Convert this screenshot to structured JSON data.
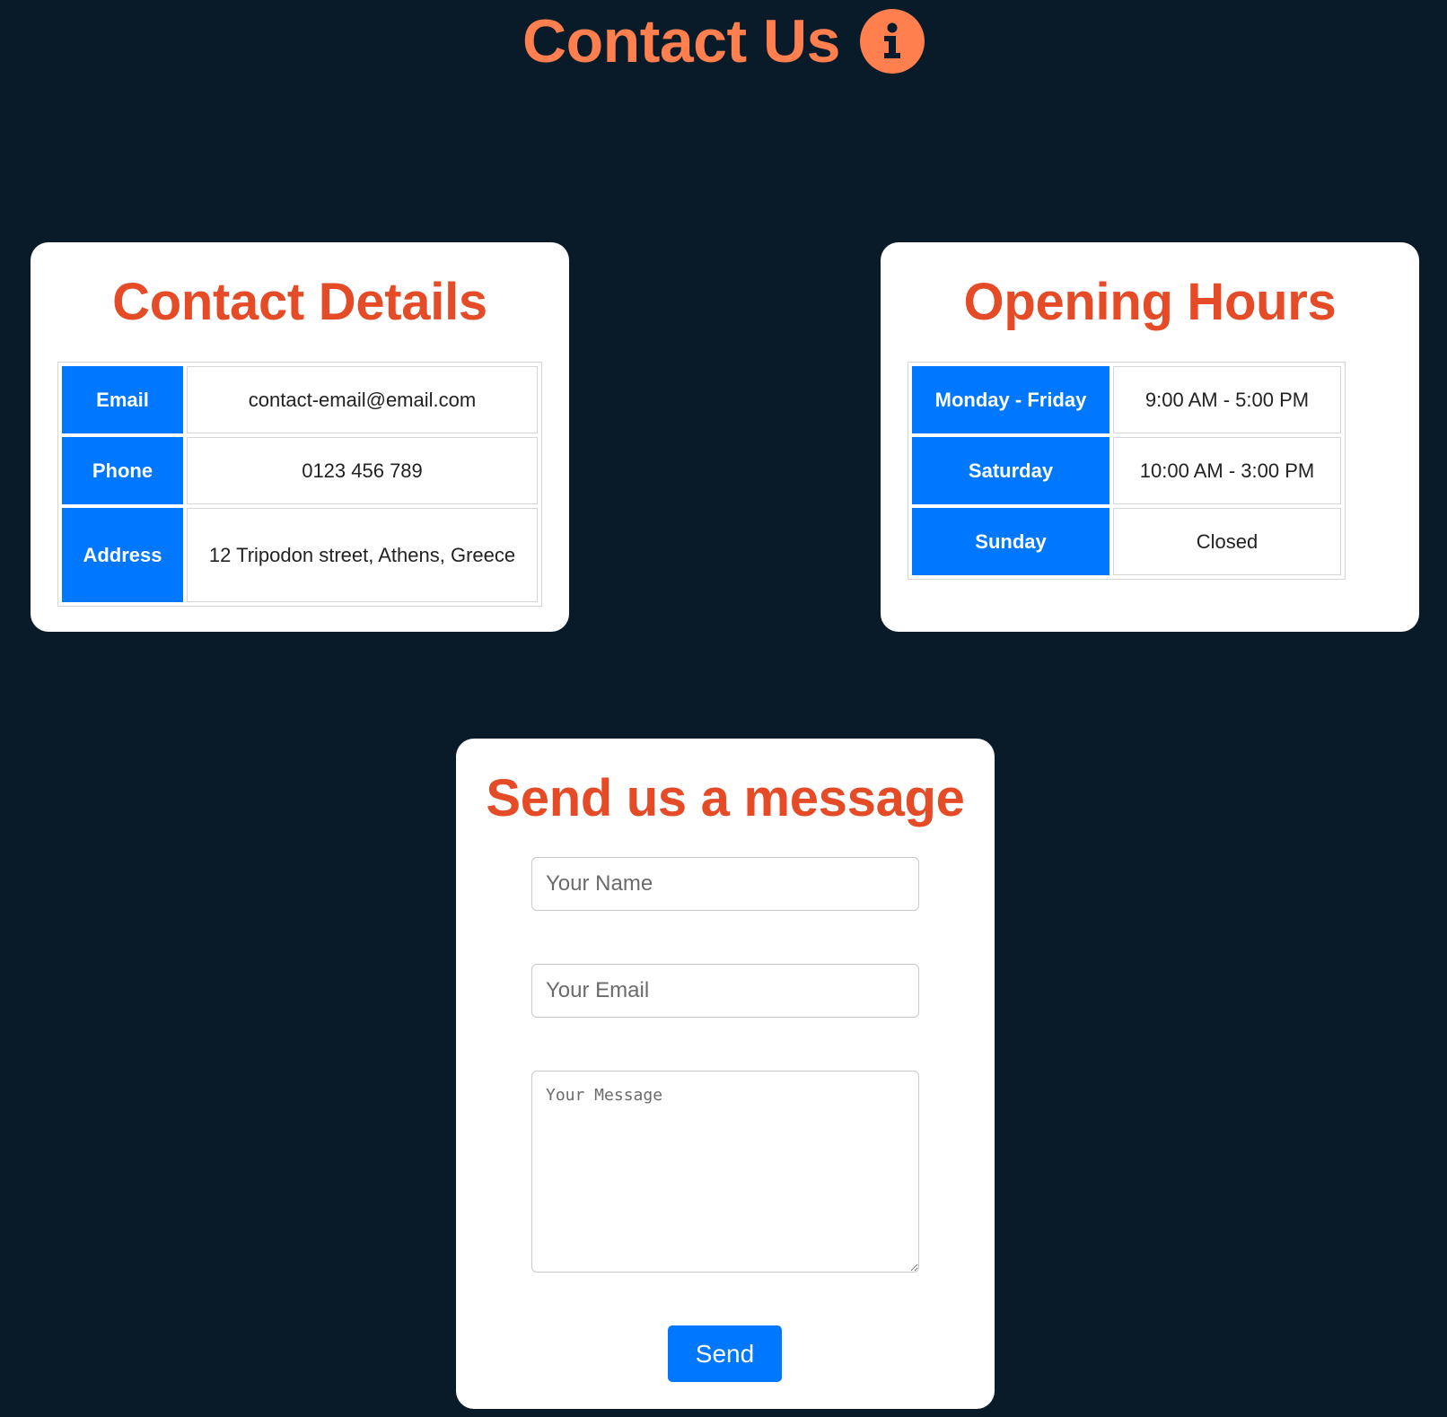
{
  "page": {
    "title": "Contact Us",
    "icon": "info-icon",
    "accent_color": "#ff7f4e"
  },
  "contact_details": {
    "title": "Contact Details",
    "rows": [
      {
        "label": "Email",
        "value": "contact-email@email.com"
      },
      {
        "label": "Phone",
        "value": "0123 456 789"
      },
      {
        "label": "Address",
        "value": "12 Tripodon street, Athens, Greece"
      }
    ]
  },
  "opening_hours": {
    "title": "Opening Hours",
    "rows": [
      {
        "label": "Monday - Friday",
        "value": "9:00 AM - 5:00 PM"
      },
      {
        "label": "Saturday",
        "value": "10:00 AM - 3:00 PM"
      },
      {
        "label": "Sunday",
        "value": "Closed"
      }
    ]
  },
  "message_form": {
    "title": "Send us a message",
    "name_placeholder": "Your Name",
    "email_placeholder": "Your Email",
    "message_placeholder": "Your Message",
    "send_label": "Send"
  },
  "colors": {
    "background": "#091a29",
    "card_title": "#e44b26",
    "label_cell": "#0077ff",
    "button": "#0077ff"
  }
}
